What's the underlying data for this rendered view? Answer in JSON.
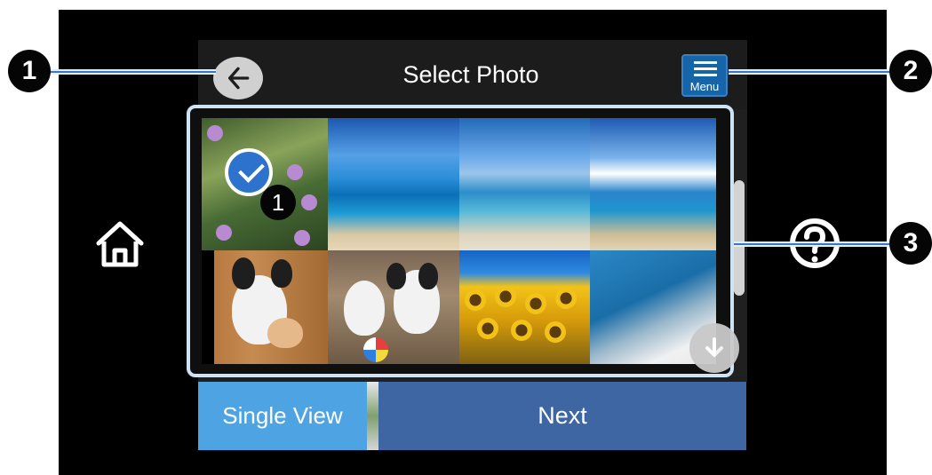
{
  "header": {
    "title": "Select Photo",
    "back_icon": "back-arrow-icon",
    "menu_icon": "menu-icon",
    "menu_label": "Menu"
  },
  "side": {
    "home_icon": "home-icon",
    "help_icon": "help-icon"
  },
  "grid": {
    "selected_count": "1",
    "photos": [
      "flowers",
      "beach",
      "beach",
      "beach",
      "dog",
      "dogs",
      "sunflowers",
      "beach"
    ]
  },
  "buttons": {
    "single_view": "Single View",
    "next": "Next"
  },
  "callouts": {
    "one": "1",
    "two": "2",
    "three": "3"
  },
  "colors": {
    "accent_blue": "#4ea3e2",
    "button_blue": "#3e66a3",
    "menu_blue": "#1565a8",
    "callout_line_blue": "#3b79ba"
  }
}
